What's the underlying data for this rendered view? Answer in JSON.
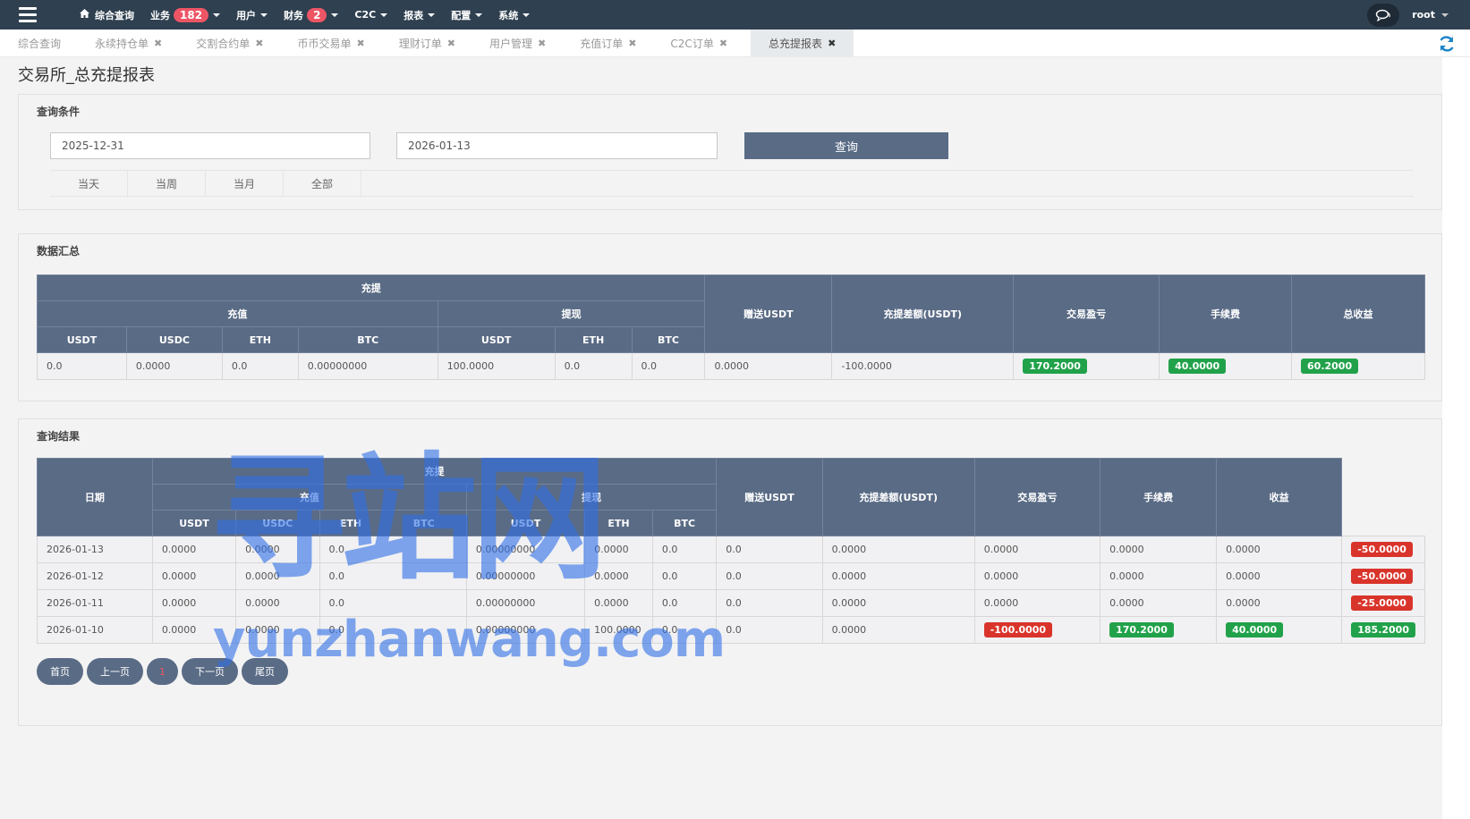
{
  "nav": {
    "home": "综合查询",
    "items": [
      {
        "label": "业务",
        "badge": "182"
      },
      {
        "label": "用户",
        "badge": null
      },
      {
        "label": "财务",
        "badge": "2"
      },
      {
        "label": "C2C",
        "badge": null
      },
      {
        "label": "报表",
        "badge": null
      },
      {
        "label": "配置",
        "badge": null
      },
      {
        "label": "系统",
        "badge": null
      }
    ],
    "user": "root"
  },
  "tabs": [
    {
      "label": "综合查询",
      "closable": false
    },
    {
      "label": "永续持仓单",
      "closable": true
    },
    {
      "label": "交割合约单",
      "closable": true
    },
    {
      "label": "币币交易单",
      "closable": true
    },
    {
      "label": "理财订单",
      "closable": true
    },
    {
      "label": "用户管理",
      "closable": true
    },
    {
      "label": "充值订单",
      "closable": true
    },
    {
      "label": "C2C订单",
      "closable": true
    },
    {
      "label": "总充提报表",
      "closable": true,
      "active": true
    }
  ],
  "page_title": "交易所_总充提报表",
  "query": {
    "title": "查询条件",
    "start_date": "2025-12-31",
    "end_date": "2026-01-13",
    "button": "查询",
    "ranges": [
      "当天",
      "当周",
      "当月",
      "全部"
    ]
  },
  "summary": {
    "title": "数据汇总",
    "h_group": "充提",
    "h_deposit": "充值",
    "h_withdraw": "提现",
    "h_gift": "赠送USDT",
    "h_diff": "充提差额(USDT)",
    "h_trade": "交易盈亏",
    "h_fee": "手续费",
    "h_total": "总收益",
    "deposit_cols": [
      "USDT",
      "USDC",
      "ETH",
      "BTC"
    ],
    "withdraw_cols": [
      "USDT",
      "ETH",
      "BTC"
    ],
    "row": {
      "dep_usdt": "0.0",
      "dep_usdc": "0.0000",
      "dep_eth": "0.0",
      "dep_btc": "0.00000000",
      "wd_usdt": "100.0000",
      "wd_eth": "0.0",
      "wd_btc": "0.0",
      "gift": "0.0000",
      "diff": "-100.0000",
      "trade": "170.2000",
      "fee": "40.0000",
      "total": "60.2000"
    }
  },
  "results": {
    "title": "查询结果",
    "h_date": "日期",
    "h_group": "充提",
    "h_deposit": "充值",
    "h_withdraw": "提现",
    "h_gift": "赠送USDT",
    "h_diff": "充提差额(USDT)",
    "h_trade": "交易盈亏",
    "h_fee": "手续费",
    "h_income": "收益",
    "deposit_cols": [
      "USDT",
      "USDC",
      "ETH",
      "BTC"
    ],
    "withdraw_cols": [
      "USDT",
      "ETH",
      "BTC"
    ],
    "rows": [
      {
        "date": "2026-01-13",
        "dep_usdt": "0.0000",
        "dep_usdc": "0.0000",
        "dep_eth": "0.0",
        "dep_btc": "0.00000000",
        "wd_usdt": "0.0000",
        "wd_eth": "0.0",
        "wd_btc": "0.0",
        "gift": "0.0000",
        "diff": "0.0000",
        "trade": "0.0000",
        "fee": "0.0000",
        "income": "-50.0000",
        "diff_lbl": "",
        "trade_lbl": "",
        "fee_lbl": "",
        "income_lbl": "red"
      },
      {
        "date": "2026-01-12",
        "dep_usdt": "0.0000",
        "dep_usdc": "0.0000",
        "dep_eth": "0.0",
        "dep_btc": "0.00000000",
        "wd_usdt": "0.0000",
        "wd_eth": "0.0",
        "wd_btc": "0.0",
        "gift": "0.0000",
        "diff": "0.0000",
        "trade": "0.0000",
        "fee": "0.0000",
        "income": "-50.0000",
        "diff_lbl": "",
        "trade_lbl": "",
        "fee_lbl": "",
        "income_lbl": "red"
      },
      {
        "date": "2026-01-11",
        "dep_usdt": "0.0000",
        "dep_usdc": "0.0000",
        "dep_eth": "0.0",
        "dep_btc": "0.00000000",
        "wd_usdt": "0.0000",
        "wd_eth": "0.0",
        "wd_btc": "0.0",
        "gift": "0.0000",
        "diff": "0.0000",
        "trade": "0.0000",
        "fee": "0.0000",
        "income": "-25.0000",
        "diff_lbl": "",
        "trade_lbl": "",
        "fee_lbl": "",
        "income_lbl": "red"
      },
      {
        "date": "2026-01-10",
        "dep_usdt": "0.0000",
        "dep_usdc": "0.0000",
        "dep_eth": "0.0",
        "dep_btc": "0.00000000",
        "wd_usdt": "100.0000",
        "wd_eth": "0.0",
        "wd_btc": "0.0",
        "gift": "0.0000",
        "diff": "-100.0000",
        "trade": "170.2000",
        "fee": "40.0000",
        "income": "185.2000",
        "diff_lbl": "red",
        "trade_lbl": "green",
        "fee_lbl": "green",
        "income_lbl": "green"
      }
    ]
  },
  "pager": {
    "first": "首页",
    "prev": "上一页",
    "current": "1",
    "next": "下一页",
    "last": "尾页"
  },
  "watermark": {
    "cn": "寻站网",
    "en": "yunzhanwang.com"
  },
  "colors": {
    "nav_bg": "#2f4050",
    "header_bg": "#5a6b85",
    "green": "#21a24a",
    "red": "#d9342b",
    "badge": "#ed5565"
  }
}
